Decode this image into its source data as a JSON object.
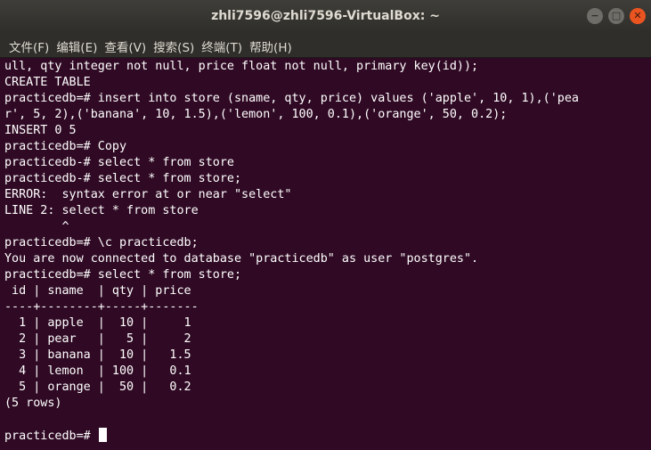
{
  "window": {
    "title": "zhli7596@zhli7596-VirtualBox: ~",
    "buttons": {
      "minimize": "−",
      "maximize": "□",
      "close": "✕"
    }
  },
  "menu": [
    "文件(F)",
    "编辑(E)",
    "查看(V)",
    "搜索(S)",
    "终端(T)",
    "帮助(H)"
  ],
  "terminal": {
    "lines": [
      "ull, qty integer not null, price float not null, primary key(id));",
      "CREATE TABLE",
      "practicedb=# insert into store (sname, qty, price) values ('apple', 10, 1),('pea",
      "r', 5, 2),('banana', 10, 1.5),('lemon', 100, 0.1),('orange', 50, 0.2);",
      "INSERT 0 5",
      "practicedb=# Copy",
      "practicedb-# select * from store",
      "practicedb-# select * from store;",
      "ERROR:  syntax error at or near \"select\"",
      "LINE 2: select * from store",
      "        ^",
      "practicedb=# \\c practicedb;",
      "You are now connected to database \"practicedb\" as user \"postgres\".",
      "practicedb=# select * from store;",
      " id | sname  | qty | price",
      "----+--------+-----+-------",
      "  1 | apple  |  10 |     1",
      "  2 | pear   |   5 |     2",
      "  3 | banana |  10 |   1.5",
      "  4 | lemon  | 100 |   0.1",
      "  5 | orange |  50 |   0.2",
      "(5 rows)",
      ""
    ],
    "prompt": "practicedb=# "
  }
}
